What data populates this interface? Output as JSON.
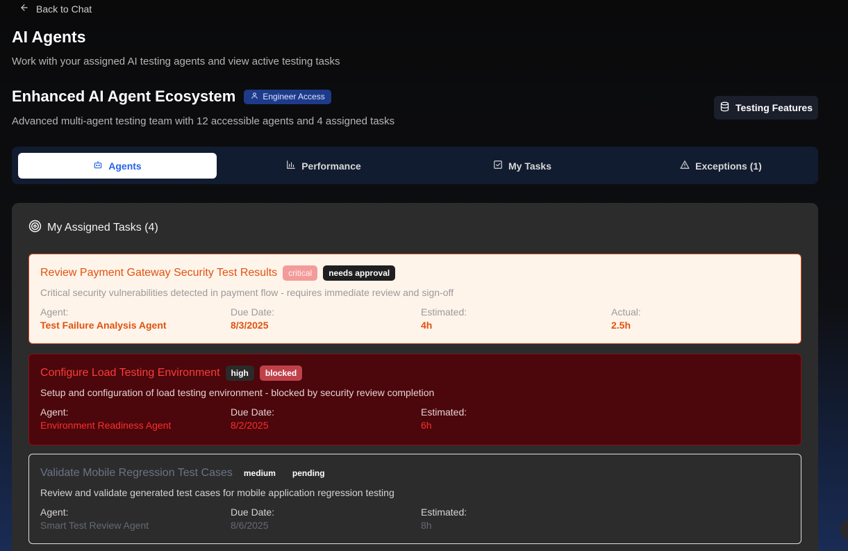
{
  "nav": {
    "back_label": "Back to Chat"
  },
  "header": {
    "title": "AI Agents",
    "subtitle": "Work with your assigned AI testing agents and view active testing tasks"
  },
  "ecosystem": {
    "title": "Enhanced AI Agent Ecosystem",
    "access_badge": "Engineer Access",
    "description": "Advanced multi-agent testing team with 12 accessible agents and 4 assigned tasks",
    "features_button": "Testing Features"
  },
  "tabs": [
    {
      "label": "Agents",
      "icon": "bot-icon",
      "active": true
    },
    {
      "label": "Performance",
      "icon": "bar-chart-icon",
      "active": false
    },
    {
      "label": "My Tasks",
      "icon": "check-square-icon",
      "active": false
    },
    {
      "label": "Exceptions (1)",
      "icon": "alert-triangle-icon",
      "active": false
    }
  ],
  "tasks_panel": {
    "title": "My Assigned Tasks (4)",
    "tasks": [
      {
        "title": "Review Payment Gateway Security Test Results",
        "priority": "critical",
        "status": "needs approval",
        "description": "Critical security vulnerabilities detected in payment flow - requires immediate review and sign-off",
        "agent_label": "Agent:",
        "agent": "Test Failure Analysis Agent",
        "due_label": "Due Date:",
        "due": "8/3/2025",
        "est_label": "Estimated:",
        "est": "4h",
        "actual_label": "Actual:",
        "actual": "2.5h"
      },
      {
        "title": "Configure Load Testing Environment",
        "priority": "high",
        "status": "blocked",
        "description": "Setup and configuration of load testing environment - blocked by security review completion",
        "agent_label": "Agent:",
        "agent": "Environment Readiness Agent",
        "due_label": "Due Date:",
        "due": "8/2/2025",
        "est_label": "Estimated:",
        "est": "6h"
      },
      {
        "title": "Validate Mobile Regression Test Cases",
        "priority": "medium",
        "status": "pending",
        "description": "Review and validate generated test cases for mobile application regression testing",
        "agent_label": "Agent:",
        "agent": "Smart Test Review Agent",
        "due_label": "Due Date:",
        "due": "8/6/2025",
        "est_label": "Estimated:",
        "est": "8h"
      }
    ]
  },
  "colors": {
    "accent": "#2563eb",
    "critical_text": "#e0520f",
    "blocked_bg": "#4b070b",
    "badge_bg": "#1e3a8a"
  }
}
